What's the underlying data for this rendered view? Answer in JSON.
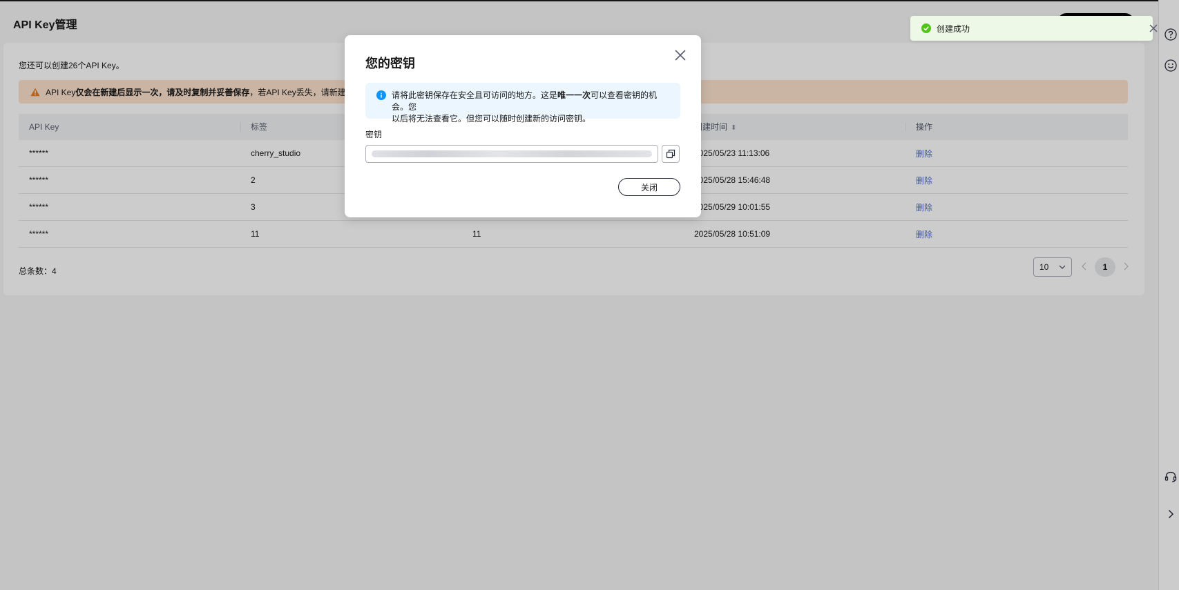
{
  "page": {
    "title": "API Key管理",
    "quota_text": "您还可以创建26个API Key。",
    "warning": {
      "prefix": "API Key",
      "bold1": "仅会在新建后显示一次，请及时复制并妥善保存",
      "middle": "，若API Key丢失，请新建API K"
    }
  },
  "table": {
    "headers": [
      "API Key",
      "标签",
      "",
      "创建时间",
      "操作"
    ],
    "rows": [
      {
        "key": "******",
        "label": "cherry_studio",
        "desc": "",
        "created": "2025/05/23 11:13:06",
        "action": "删除"
      },
      {
        "key": "******",
        "label": "2",
        "desc": "",
        "created": "2025/05/28 15:46:48",
        "action": "删除"
      },
      {
        "key": "******",
        "label": "3",
        "desc": "",
        "created": "2025/05/29 10:01:55",
        "action": "删除"
      },
      {
        "key": "******",
        "label": "11",
        "desc": "11",
        "created": "2025/05/28 10:51:09",
        "action": "删除"
      }
    ]
  },
  "footer": {
    "total_label": "总条数：",
    "total": "4",
    "page_size": "10",
    "current_page": "1"
  },
  "modal": {
    "title": "您的密钥",
    "info_line1_a": "请将此密钥保存在安全且可访问的地方。这是",
    "info_line1_bold": "唯一一次",
    "info_line1_b": "可以查看密钥的机会。您",
    "info_line2": "以后将无法查看它。但您可以随时创建新的访问密钥。",
    "key_label": "密钥",
    "close_label": "关闭"
  },
  "toast": {
    "text": "创建成功",
    "color": "#52c41a"
  },
  "icons": [
    "warning-icon",
    "info-icon",
    "copy-icon",
    "close-icon",
    "check-circle-icon",
    "help-icon",
    "smile-icon",
    "headset-icon",
    "chevron-right-icon"
  ]
}
